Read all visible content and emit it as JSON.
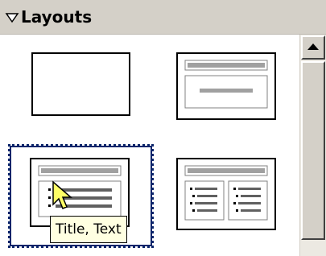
{
  "header": {
    "title": "Layouts",
    "toggle_icon": "triangle-down-icon"
  },
  "layouts": [
    {
      "id": "blank"
    },
    {
      "id": "title-content"
    },
    {
      "id": "title-text",
      "selected": true
    },
    {
      "id": "title-two-columns"
    }
  ],
  "tooltip": {
    "text": "Title, Text"
  },
  "colors": {
    "header_bg": "#d4d0c8",
    "selection": "#0a246a",
    "tooltip_bg": "#ffffe1",
    "bar_grey": "#a0a0a0",
    "cursor_fill": "#ffff66"
  },
  "icons": {
    "scroll_up": "arrow-up-icon",
    "cursor": "arrow-cursor-icon"
  }
}
